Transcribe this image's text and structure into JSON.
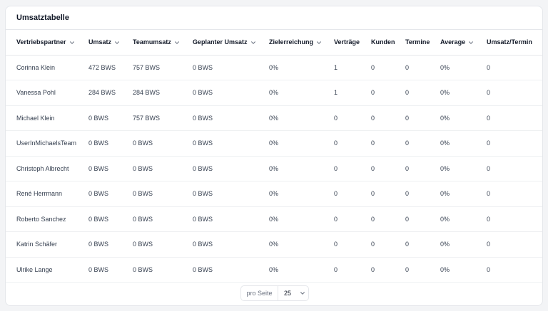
{
  "card": {
    "title": "Umsatztabelle"
  },
  "table": {
    "columns": [
      {
        "label": "Vertriebspartner",
        "sortable": true
      },
      {
        "label": "Umsatz",
        "sortable": true
      },
      {
        "label": "Teamumsatz",
        "sortable": true
      },
      {
        "label": "Geplanter Umsatz",
        "sortable": true
      },
      {
        "label": "Zielerreichung",
        "sortable": true
      },
      {
        "label": "Verträge",
        "sortable": false
      },
      {
        "label": "Kunden",
        "sortable": false
      },
      {
        "label": "Termine",
        "sortable": false
      },
      {
        "label": "Average",
        "sortable": true
      },
      {
        "label": "Umsatz/Termin",
        "sortable": false
      }
    ],
    "rows": [
      [
        "Corinna Klein",
        "472 BWS",
        "757 BWS",
        "0 BWS",
        "0%",
        "1",
        "0",
        "0",
        "0%",
        "0"
      ],
      [
        "Vanessa Pohl",
        "284 BWS",
        "284 BWS",
        "0 BWS",
        "0%",
        "1",
        "0",
        "0",
        "0%",
        "0"
      ],
      [
        "Michael Klein",
        "0 BWS",
        "757 BWS",
        "0 BWS",
        "0%",
        "0",
        "0",
        "0",
        "0%",
        "0"
      ],
      [
        "UserInMichaelsTeam",
        "0 BWS",
        "0 BWS",
        "0 BWS",
        "0%",
        "0",
        "0",
        "0",
        "0%",
        "0"
      ],
      [
        "Christoph Albrecht",
        "0 BWS",
        "0 BWS",
        "0 BWS",
        "0%",
        "0",
        "0",
        "0",
        "0%",
        "0"
      ],
      [
        "René Herrmann",
        "0 BWS",
        "0 BWS",
        "0 BWS",
        "0%",
        "0",
        "0",
        "0",
        "0%",
        "0"
      ],
      [
        "Roberto Sanchez",
        "0 BWS",
        "0 BWS",
        "0 BWS",
        "0%",
        "0",
        "0",
        "0",
        "0%",
        "0"
      ],
      [
        "Katrin Schäfer",
        "0 BWS",
        "0 BWS",
        "0 BWS",
        "0%",
        "0",
        "0",
        "0",
        "0%",
        "0"
      ],
      [
        "Ulrike Lange",
        "0 BWS",
        "0 BWS",
        "0 BWS",
        "0%",
        "0",
        "0",
        "0",
        "0%",
        "0"
      ]
    ]
  },
  "pagination": {
    "per_page_label": "pro Seite",
    "per_page_value": "25"
  }
}
